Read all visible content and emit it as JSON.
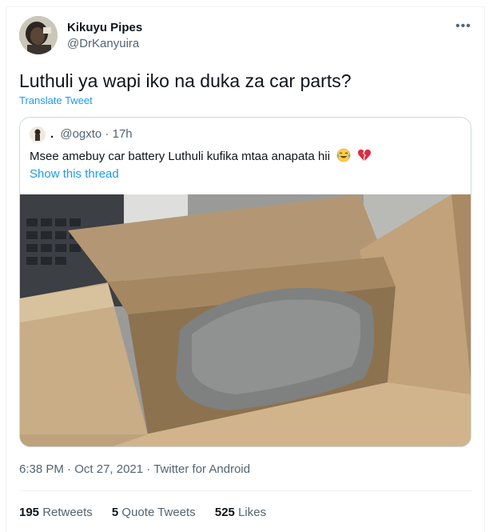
{
  "author": {
    "name": "Kikuyu Pipes",
    "handle": "@DrKanyuira"
  },
  "tweet": {
    "text": "Luthuli ya wapi iko na duka za car parts?",
    "translate_label": "Translate Tweet"
  },
  "quoted": {
    "name": ".",
    "handle": "@ogxto",
    "separator": "·",
    "time": "17h",
    "text": "Msee amebuy car battery Luthuli kufika mtaa anapata hii",
    "emojis": [
      "face-with-tears-of-joy",
      "broken-heart"
    ],
    "thread_link": "Show this thread"
  },
  "meta": {
    "time": "6:38 PM",
    "sep1": "·",
    "date": "Oct 27, 2021",
    "sep2": "·",
    "source": "Twitter for Android"
  },
  "stats": {
    "retweets_count": "195",
    "retweets_label": "Retweets",
    "quotes_count": "5",
    "quotes_label": "Quote Tweets",
    "likes_count": "525",
    "likes_label": "Likes"
  },
  "colors": {
    "link": "#1d9bf0",
    "secondary_text": "#536471",
    "primary_text": "#0f1419",
    "border": "#cfd9de"
  }
}
